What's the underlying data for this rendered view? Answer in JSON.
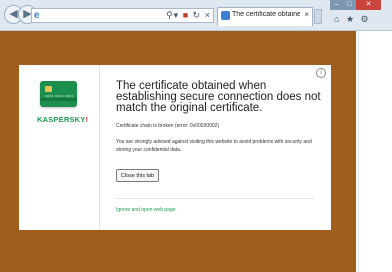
{
  "browser": {
    "address_bar": {
      "value": "",
      "browser_icon": "ie-logo-icon",
      "tools": [
        "search-dropdown-icon",
        "lock-icon",
        "refresh-icon",
        "close-icon"
      ]
    },
    "tab": {
      "title": "The certificate obtaine...",
      "close": "×"
    },
    "window_controls": {
      "minimize": "–",
      "maximize": "□",
      "close": "✕"
    },
    "command_icons": [
      "home-icon",
      "favorites-star-icon",
      "gear-icon"
    ]
  },
  "panel": {
    "brand": {
      "logo_main": "KASPERSKY",
      "logo_accent": "!"
    },
    "title": "The certificate obtained when establishing secure connection does not match the original certificate.",
    "chain_error": "Certificate chain is broken (error: 0x00030002)",
    "advice": "You are strongly advised against visiting this website to avoid problems with security and storing your confidential data.",
    "close_button": "Close this tab",
    "ignore_link": "Ignore and open web page",
    "info": "i"
  },
  "colors": {
    "page_background": "#9e5e1e",
    "brand_green": "#1f9a53",
    "brand_red": "#d02a2a",
    "card_green": "#1c8f4e"
  }
}
